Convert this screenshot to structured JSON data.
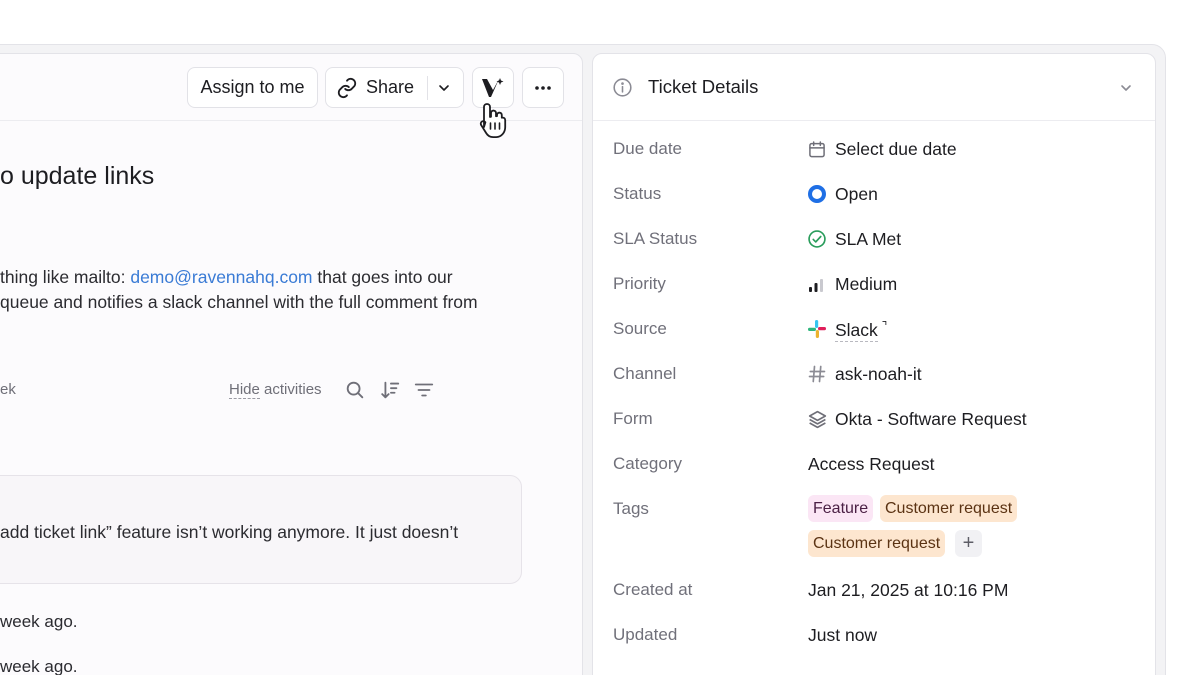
{
  "toolbar": {
    "assign_label": "Assign to me",
    "share_label": "Share"
  },
  "ticket": {
    "title": "o update links",
    "desc_line1_pre": "thing like mailto: ",
    "desc_email": "demo@ravennahq.com",
    "desc_line1_post": " that goes into our",
    "desc_line2": "queue and notifies a slack channel with the full comment from"
  },
  "activity": {
    "left_text": "ek",
    "hide_word": "Hide",
    "activities_word": " activities",
    "comment_text": "add ticket link” feature isn’t working anymore. It just doesn’t",
    "log1": "week ago.",
    "log2": "week ago."
  },
  "details": {
    "title": "Ticket Details",
    "labels": {
      "due_date": "Due date",
      "status": "Status",
      "sla_status": "SLA Status",
      "priority": "Priority",
      "source": "Source",
      "channel": "Channel",
      "form": "Form",
      "category": "Category",
      "tags": "Tags",
      "created_at": "Created at",
      "updated": "Updated"
    },
    "values": {
      "due_date": "Select due date",
      "status": "Open",
      "sla_status": "SLA Met",
      "priority": "Medium",
      "source": "Slack",
      "channel": "ask-noah-it",
      "form": "Okta - Software Request",
      "category": "Access Request",
      "created_at": "Jan 21, 2025 at 10:16 PM",
      "updated": "Just now"
    },
    "tags": [
      "Feature",
      "Customer request",
      "Customer request"
    ],
    "add_tag_symbol": "+",
    "external_symbol": "⌝"
  },
  "colors": {
    "status_open": "#1f6fe5",
    "sla_met": "#2a9d5c",
    "link": "#3a7bd5",
    "tag_feature_bg": "#fbe6f5",
    "tag_customer_bg": "#fde6cf"
  }
}
